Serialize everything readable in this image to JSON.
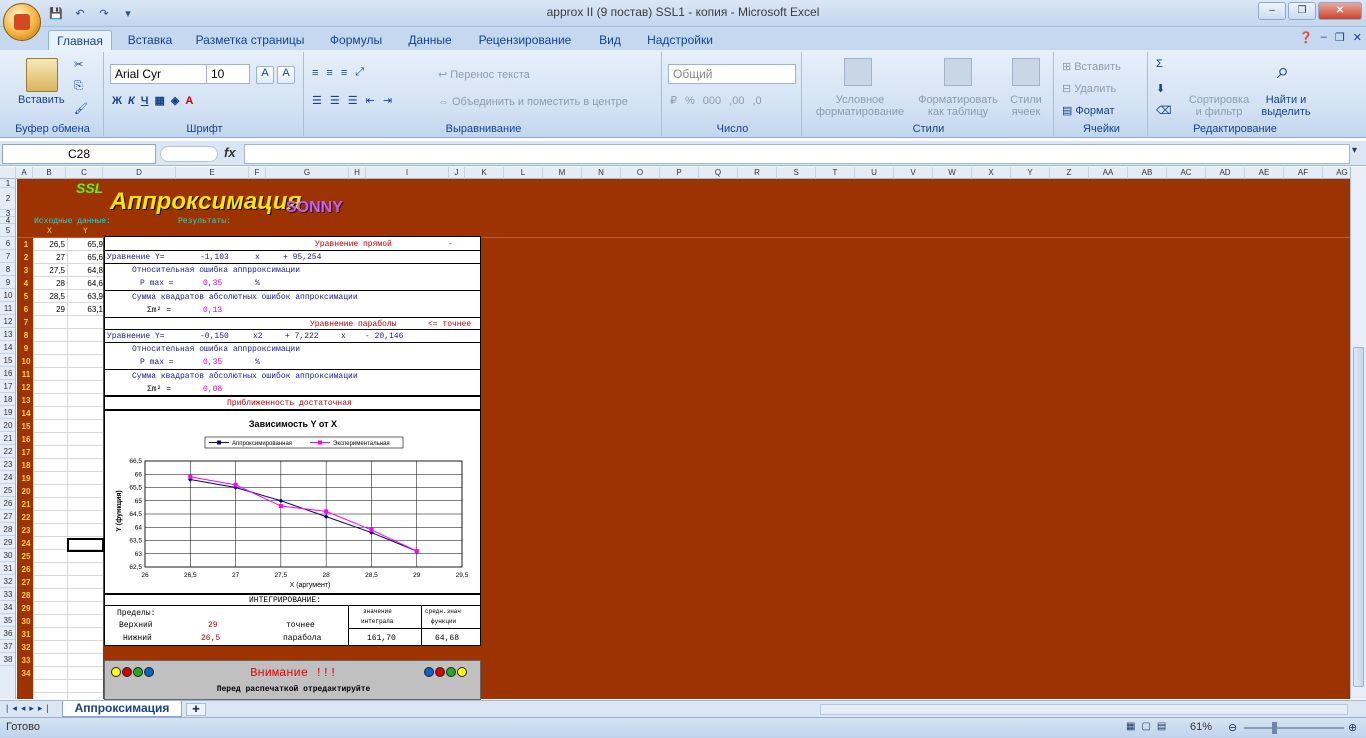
{
  "window": {
    "title": "approx II (9 постав) SSL1 - копия - Microsoft Excel"
  },
  "tabs": [
    "Главная",
    "Вставка",
    "Разметка страницы",
    "Формулы",
    "Данные",
    "Рецензирование",
    "Вид",
    "Надстройки"
  ],
  "ribbon": {
    "paste": "Вставить",
    "clipboard": "Буфер обмена",
    "font_name": "Arial Cyr",
    "font_size": "10",
    "font_group": "Шрифт",
    "wrap": "Перенос текста",
    "merge": "Объединить и поместить в центре",
    "align_group": "Выравнивание",
    "number_format": "Общий",
    "number_group": "Число",
    "cond_format": "Условное",
    "cond_format2": "форматирование",
    "format_table": "Форматировать",
    "format_table2": "как таблицу",
    "cell_styles": "Стили",
    "cell_styles2": "ячеек",
    "styles_group": "Стили",
    "insert": "Вставить",
    "delete": "Удалить",
    "format": "Формат",
    "cells_group": "Ячейки",
    "sort": "Сортировка",
    "sort2": "и фильтр",
    "find": "Найти и",
    "find2": "выделить",
    "edit_group": "Редактирование"
  },
  "formula_bar": {
    "name_box": "C28",
    "fx": "fx",
    "value": ""
  },
  "columns": [
    "A",
    "B",
    "C",
    "D",
    "E",
    "F",
    "G",
    "H",
    "I",
    "J",
    "K",
    "L",
    "M",
    "N",
    "O",
    "P",
    "Q",
    "R",
    "S",
    "T",
    "U",
    "V",
    "W",
    "X",
    "Y",
    "Z",
    "AA",
    "AB",
    "AC",
    "AD",
    "AE",
    "AF",
    "AG"
  ],
  "rows": [
    "1",
    "2",
    "3",
    "4",
    "5",
    "6",
    "7",
    "8",
    "9",
    "10",
    "11",
    "12",
    "13",
    "14",
    "15",
    "16",
    "17",
    "18",
    "19",
    "20",
    "21",
    "22",
    "23",
    "24",
    "25",
    "26",
    "27",
    "28",
    "29",
    "30",
    "31",
    "32",
    "33",
    "34",
    "35",
    "36",
    "37",
    "38"
  ],
  "sheet": {
    "logo_ssl": "SSL",
    "logo_main": "Аппроксимация",
    "logo_sonny": "SONNY",
    "src_label": "Исходные данные:",
    "res_label": "Результаты:",
    "x_head": "X",
    "y_head": "Y",
    "data_x": [
      "26,5",
      "27",
      "27,5",
      "28",
      "28,5",
      "29"
    ],
    "data_y": [
      "65,9",
      "65,6",
      "64,8",
      "64,6",
      "63,9",
      "63,1"
    ],
    "row_index": [
      "1",
      "2",
      "3",
      "4",
      "5",
      "6",
      "7",
      "8",
      "9",
      "10",
      "11",
      "12",
      "13",
      "14",
      "15",
      "16",
      "17",
      "18",
      "19",
      "20",
      "21",
      "22",
      "23",
      "24",
      "25",
      "26",
      "27",
      "28",
      "29",
      "30",
      "31",
      "32",
      "33",
      "34"
    ]
  },
  "results": {
    "line_title": "Уравнение прямой",
    "line_dash": "-",
    "line_eq_label": "Уравнение Y=",
    "line_a": "-1,103",
    "line_x": "x",
    "line_b": "+ 95,254",
    "rel_err": "Относительная ошибка аппрроксимации",
    "pmax_label": "P max =",
    "line_pmax": "0,35",
    "pct": "%",
    "sum_sq": "Сумма квадратов абсолютных ошибок аппроксимации",
    "sum_sym": "Σm² =",
    "line_sum": "0,13",
    "par_title": "Уравнение параболы",
    "par_note": "<= точнее",
    "par_eq_label": "Уравнение Y=",
    "par_a": "-0,150",
    "par_x2": "x2",
    "par_b": "+ 7,222",
    "par_x": "x",
    "par_c": "- 20,146",
    "par_pmax": "0,35",
    "par_sum": "0,08",
    "adequate": "Приближенность достаточная"
  },
  "chart_data": {
    "type": "line",
    "title": "Зависимость Y от X",
    "xlabel": "X (аргумент)",
    "ylabel": "Y (функция)",
    "xlim": [
      26,
      29.5
    ],
    "ylim": [
      62.5,
      66.5
    ],
    "xticks": [
      "26",
      "26,5",
      "27",
      "27,5",
      "28",
      "28,5",
      "29",
      "29,5"
    ],
    "yticks": [
      "62,5",
      "63",
      "63,5",
      "64",
      "64,5",
      "65",
      "65,5",
      "66",
      "66,5"
    ],
    "legend": "top",
    "series": [
      {
        "name": "Аппроксимированная",
        "color": "#00008b",
        "x": [
          26.5,
          27,
          27.5,
          28,
          28.5,
          29
        ],
        "y": [
          65.8,
          65.5,
          65.0,
          64.4,
          63.8,
          63.1
        ]
      },
      {
        "name": "Экспериментальная",
        "color": "#ff00ff",
        "x": [
          26.5,
          27,
          27.5,
          28,
          28.5,
          29
        ],
        "y": [
          65.9,
          65.6,
          64.8,
          64.6,
          63.9,
          63.1
        ]
      }
    ]
  },
  "integration": {
    "title": "ИНТЕГРИРОВАНИЕ:",
    "limits": "Пределы:",
    "upper": "Верхний",
    "lower": "Нижний",
    "upper_val": "29",
    "lower_val": "26,5",
    "more_exact": "точнее",
    "parabola": "парабола",
    "col_value": "значение",
    "col_value2": "интеграла",
    "col_avg": "средн.знач",
    "col_avg2": "функции",
    "integral": "161,70",
    "avg": "64,68"
  },
  "notice": {
    "title": "Внимание !!!",
    "text": "Перед распечаткой отредактируйте"
  },
  "sheet_tabs": {
    "active": "Аппроксимация"
  },
  "status": {
    "ready": "Готово",
    "zoom": "61%"
  }
}
